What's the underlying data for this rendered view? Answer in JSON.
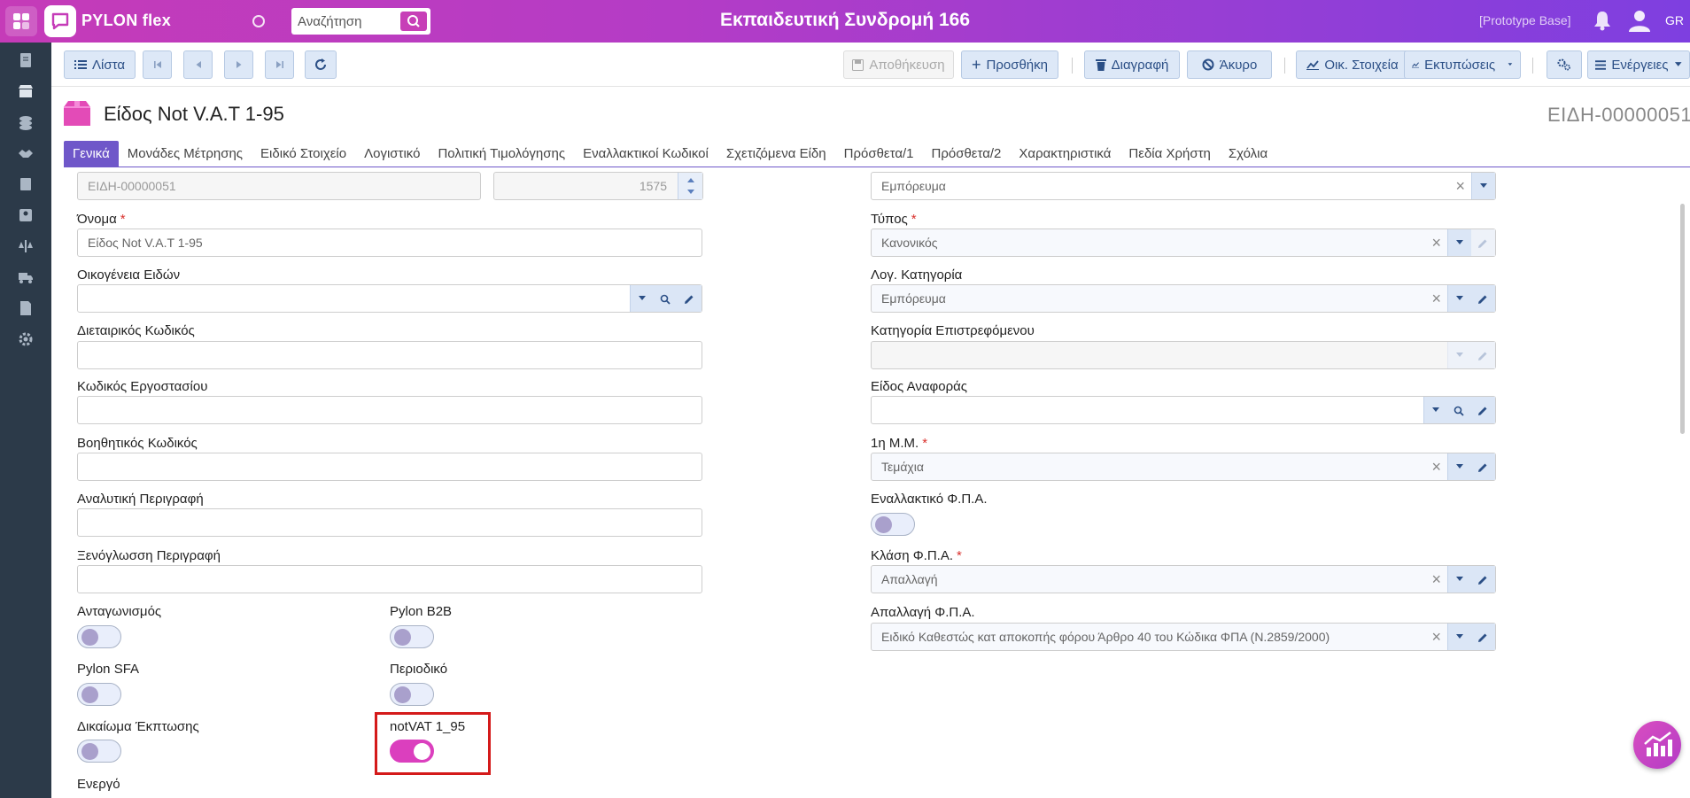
{
  "topbar": {
    "brand": "PYLON flex",
    "search_placeholder": "Αναζήτηση",
    "title": "Εκπαιδευτική Συνδρομή 166",
    "database": "[Prototype Base]",
    "language": "GR"
  },
  "toolbar": {
    "list": "Λίστα",
    "save": "Αποθήκευση",
    "add": "Προσθήκη",
    "delete": "Διαγραφή",
    "cancel": "Άκυρο",
    "financial": "Οικ. Στοιχεία",
    "prints": "Εκτυπώσεις",
    "actions": "Ενέργειες"
  },
  "record": {
    "title": "Είδος Not V.A.T 1-95",
    "code": "ΕΙΔΗ-00000051"
  },
  "tabs": [
    "Γενικά",
    "Μονάδες Μέτρησης",
    "Ειδικό Στοιχείο",
    "Λογιστικό",
    "Πολιτική Τιμολόγησης",
    "Εναλλακτικοί Κωδικοί",
    "Σχετιζόμενα Είδη",
    "Πρόσθετα/1",
    "Πρόσθετα/2",
    "Χαρακτηριστικά",
    "Πεδία Χρήστη",
    "Σχόλια"
  ],
  "active_tab": "Γενικά",
  "left": {
    "code_value": "ΕΙΔΗ-00000051",
    "number_value": "1575",
    "name_label": "Όνομα",
    "name_value": "Είδος Not V.A.T 1-95",
    "family_label": "Οικογένεια Ειδών",
    "family_value": "",
    "retail_label": "Διεταιρικός Κωδικός",
    "retail_value": "",
    "factory_label": "Κωδικός Εργοστασίου",
    "factory_value": "",
    "aux_label": "Βοηθητικός Κωδικός",
    "aux_value": "",
    "desc_label": "Αναλυτική Περιγραφή",
    "desc_value": "",
    "foreign_label": "Ξενόγλωσση Περιγραφή",
    "foreign_value": ""
  },
  "toggles": [
    {
      "label": "Ανταγωνισμός",
      "on": false
    },
    {
      "label": "Pylon B2B",
      "on": false
    },
    {
      "label": "Pylon SFA",
      "on": false
    },
    {
      "label": "Περιοδικό",
      "on": false
    },
    {
      "label": "Δικαίωμα Έκπτωσης",
      "on": false
    },
    {
      "label": "notVAT 1_95",
      "on": true
    },
    {
      "label": "Ενεργό",
      "on": null
    }
  ],
  "right": {
    "category_value": "Εμπόρευμα",
    "type_label": "Τύπος",
    "type_value": "Κανονικός",
    "acc_label": "Λογ. Κατηγορία",
    "acc_value": "Εμπόρευμα",
    "return_label": "Κατηγορία Επιστρεφόμενου",
    "return_value": "",
    "ref_label": "Είδος Αναφοράς",
    "ref_value": "",
    "mu_label": "1η Μ.Μ.",
    "mu_value": "Τεμάχια",
    "altvat_label": "Εναλλακτικό Φ.Π.Α.",
    "altvat_on": false,
    "vatclass_label": "Κλάση Φ.Π.Α.",
    "vatclass_value": "Απαλλαγή",
    "vatexempt_label": "Απαλλαγή Φ.Π.Α.",
    "vatexempt_value": "Ειδικό Καθεστώς κατ αποκοπής φόρου  Άρθρο 40 του Κώδικα ΦΠΑ (Ν.2859/2000)"
  },
  "colors": {
    "accent": "#c53bb8",
    "tab_active": "#6f57c9",
    "toggle_on": "#db3fbe",
    "highlight": "#d41a1a",
    "sidebar": "#2c3a49"
  }
}
